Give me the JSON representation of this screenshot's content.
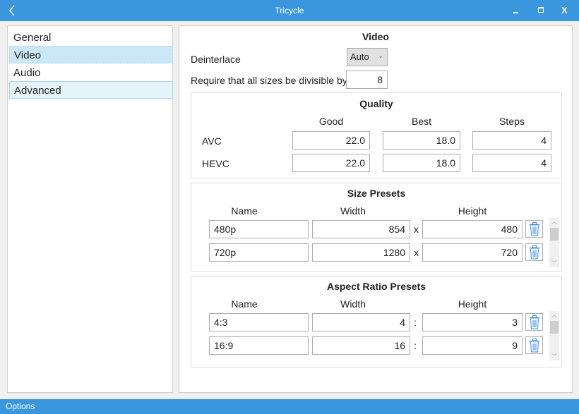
{
  "window": {
    "title": "Tricycle",
    "back_icon": "chevron-left-icon",
    "minimize_icon": "minimize-icon",
    "maximize_icon": "maximize-icon",
    "close_icon": "close-icon",
    "close_label": "X"
  },
  "sidebar": {
    "items": [
      {
        "label": "General",
        "selected": false
      },
      {
        "label": "Video",
        "selected": true
      },
      {
        "label": "Audio",
        "selected": false
      },
      {
        "label": "Advanced",
        "selected": false,
        "highlighted": true
      }
    ]
  },
  "main": {
    "title": "Video",
    "deinterlace_label": "Deinterlace",
    "deinterlace_value": "Auto",
    "divisible_label": "Require that all sizes be divisible by",
    "divisible_value": "8",
    "quality": {
      "title": "Quality",
      "headers": [
        "Good",
        "Best",
        "Steps"
      ],
      "rows": [
        {
          "label": "AVC",
          "good": "22.0",
          "best": "18.0",
          "steps": "4"
        },
        {
          "label": "HEVC",
          "good": "22.0",
          "best": "18.0",
          "steps": "4"
        }
      ]
    },
    "size_presets": {
      "title": "Size Presets",
      "headers": [
        "Name",
        "Width",
        "Height"
      ],
      "separator": "x",
      "rows": [
        {
          "name": "480p",
          "width": "854",
          "height": "480"
        },
        {
          "name": "720p",
          "width": "1280",
          "height": "720"
        }
      ]
    },
    "aspect_presets": {
      "title": "Aspect Ratio Presets",
      "headers": [
        "Name",
        "Width",
        "Height"
      ],
      "separator": ":",
      "rows": [
        {
          "name": "4:3",
          "width": "4",
          "height": "3"
        },
        {
          "name": "16:9",
          "width": "16",
          "height": "9"
        }
      ]
    }
  },
  "status_bar": {
    "label": "Options"
  },
  "colors": {
    "accent": "#3a96dd",
    "selected": "#cce8f7",
    "trash": "#3a8ee6"
  }
}
